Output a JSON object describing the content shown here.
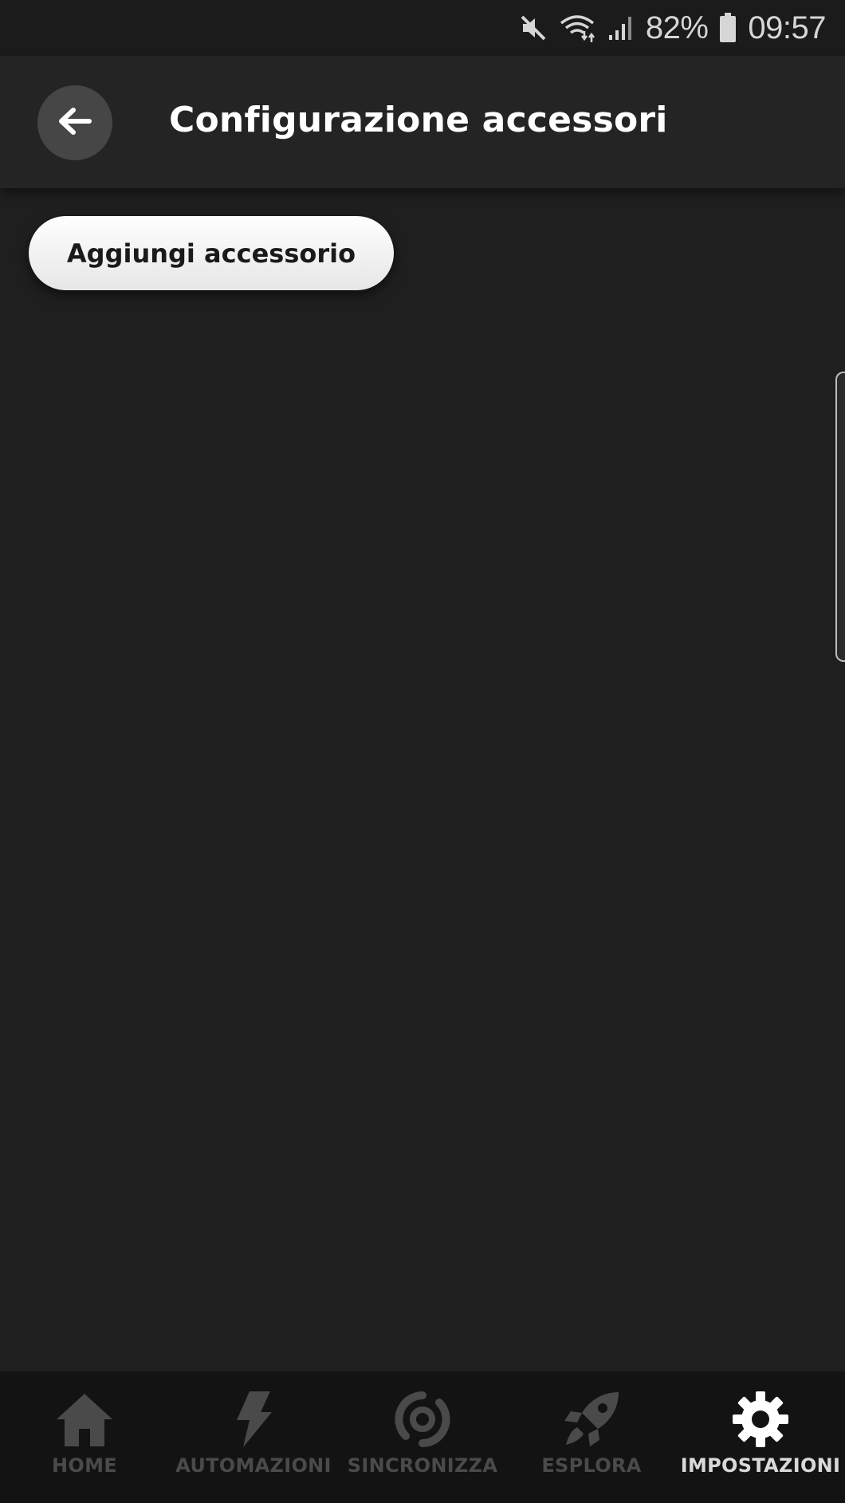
{
  "status_bar": {
    "battery_percent": "82%",
    "time": "09:57",
    "icons": [
      "mute-icon",
      "wifi-icon",
      "signal-icon",
      "battery-icon"
    ]
  },
  "header": {
    "title": "Configurazione accessori",
    "back_icon": "arrow-left-icon"
  },
  "main": {
    "add_button_label": "Aggiungi accessorio"
  },
  "bottom_nav": {
    "items": [
      {
        "label": "HOME",
        "icon": "house-icon",
        "active": false
      },
      {
        "label": "AUTOMAZIONI",
        "icon": "lightning-icon",
        "active": false
      },
      {
        "label": "SINCRONIZZA",
        "icon": "sync-icon",
        "active": false
      },
      {
        "label": "ESPLORA",
        "icon": "rocket-icon",
        "active": false
      },
      {
        "label": "IMPOSTAZIONI",
        "icon": "gear-icon",
        "active": true
      }
    ]
  },
  "colors": {
    "background": "#1f1f1f",
    "header": "#242424",
    "nav_background": "#131313",
    "nav_inactive": "#4a4a4a",
    "nav_active": "#ffffff"
  }
}
